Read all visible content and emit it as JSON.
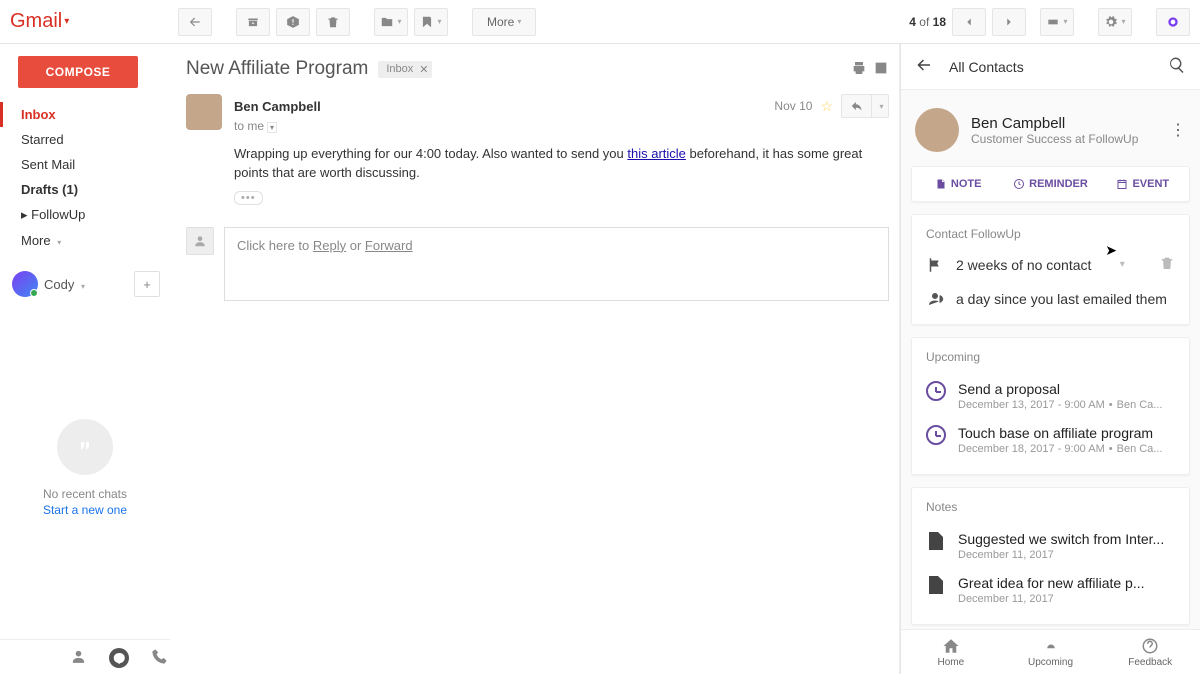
{
  "logo": "Gmail",
  "toolbar": {
    "more": "More",
    "pager": {
      "pos": "4",
      "of": "of",
      "total": "18"
    }
  },
  "sidebar": {
    "compose": "COMPOSE",
    "items": [
      "Inbox",
      "Starred",
      "Sent Mail",
      "Drafts (1)",
      "FollowUp",
      "More"
    ],
    "chat_user": "Cody",
    "hangouts_empty": "No recent chats",
    "hangouts_link": "Start a new one"
  },
  "message": {
    "subject": "New Affiliate Program",
    "label": "Inbox",
    "sender": "Ben Campbell",
    "recipient": "to me",
    "date": "Nov 10",
    "body_1": "Wrapping up everything for our 4:00 today.  Also wanted to send you ",
    "body_link": "this article",
    "body_2": " beforehand, it has some great points that are worth discussing.",
    "reply_prompt_1": "Click here to ",
    "reply_prompt_2": "Reply",
    "reply_prompt_3": " or ",
    "reply_prompt_4": "Forward"
  },
  "panel": {
    "header": "All Contacts",
    "contact": {
      "name": "Ben Campbell",
      "role": "Customer Success at FollowUp"
    },
    "tabs": {
      "note": "NOTE",
      "reminder": "REMINDER",
      "event": "EVENT"
    },
    "followup": {
      "title": "Contact FollowUp",
      "rule": "2 weeks of no contact",
      "status": "a day since you last emailed them"
    },
    "upcoming": {
      "title": "Upcoming",
      "items": [
        {
          "title": "Send a proposal",
          "sub": "December 13, 2017 - 9:00 AM",
          "owner": "Ben Ca..."
        },
        {
          "title": "Touch base on affiliate program",
          "sub": "December 18, 2017 - 9:00 AM",
          "owner": "Ben Ca..."
        }
      ]
    },
    "notes": {
      "title": "Notes",
      "items": [
        {
          "title": "Suggested we switch from Inter...",
          "sub": "December 11, 2017"
        },
        {
          "title": "Great idea for new affiliate p...",
          "sub": "December 11, 2017"
        }
      ]
    },
    "footer": {
      "home": "Home",
      "upcoming": "Upcoming",
      "feedback": "Feedback"
    }
  }
}
